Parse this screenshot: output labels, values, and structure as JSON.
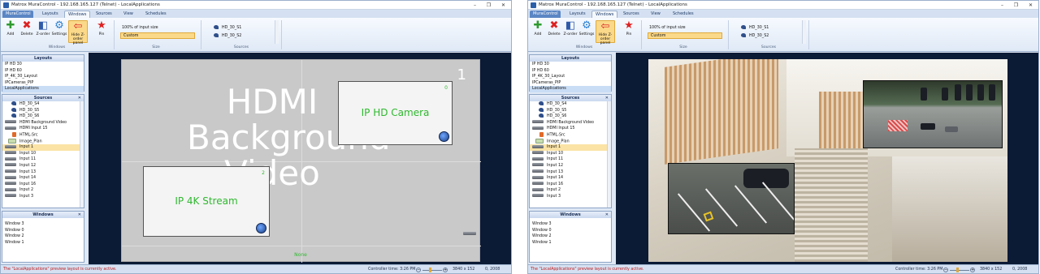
{
  "left_window": {
    "title": "Matrox MuraControl - 192.168.165.127 (Telnet) - LocalApplications",
    "menu_tabs": [
      "MuraControl",
      "Layouts",
      "Windows",
      "Sources",
      "View",
      "Schedules"
    ],
    "ribbon": {
      "buttons": [
        "Add",
        "Delete",
        "Z-order",
        "Settings",
        "Hide Z-order panel",
        "Pin"
      ],
      "group_windows": "Windows",
      "size_text": "100% of input size",
      "size_value": "Custom",
      "group_size": "Size",
      "sources": [
        "HD_30_S1",
        "HD_30_S2"
      ],
      "group_sources": "Sources"
    },
    "layouts": {
      "header": "Layouts",
      "items": [
        "IP HD 30",
        "IP HD 60",
        "IP_4K_30_Layout",
        "IPCameras_PIP",
        "LocalApplications"
      ]
    },
    "sources_panel": {
      "header": "Sources",
      "close": "✕",
      "items": [
        "HD_30_S4",
        "HD_30_S5",
        "HD_30_S6",
        "HDMI Background Video",
        "HDMI Input 15",
        "HTML-Src",
        "Image_Plan",
        "Input 1",
        "Input 10",
        "Input 11",
        "Input 12",
        "Input 13",
        "Input 14",
        "Input 16",
        "Input 2",
        "Input 3"
      ]
    },
    "windows_panel": {
      "header": "Windows",
      "close": "✕",
      "items": [
        "Window 3",
        "Window 0",
        "Window 2",
        "Window 1"
      ]
    },
    "preview": {
      "bg_lines": [
        "HDMI",
        "Background",
        "Video"
      ],
      "screen_number": "1",
      "win_ip_hd": {
        "label": "IP HD Camera",
        "number": "0"
      },
      "win_ip_4k": {
        "label": "IP 4K Stream",
        "number": "2"
      },
      "none_label": "None"
    },
    "status": {
      "message": "The \"LocalApplications\" preview layout is currently active.",
      "controller_time": "Controller time: 3:26 PM",
      "resolution": "3840 x 152",
      "coords": "0, 2008"
    }
  },
  "right_window": {
    "title": "Matrox MuraControl - 192.168.165.127 (Telnet) - LocalApplications",
    "menu_tabs": [
      "MuraControl",
      "Layouts",
      "Windows",
      "Sources",
      "View",
      "Schedules"
    ],
    "ribbon": {
      "buttons": [
        "Add",
        "Delete",
        "Z-order",
        "Settings",
        "Hide Z-order panel",
        "Pin"
      ],
      "group_windows": "Windows",
      "size_text": "100% of input size",
      "size_value": "Custom",
      "group_size": "Size",
      "sources": [
        "HD_30_S1",
        "HD_30_S2"
      ],
      "group_sources": "Sources"
    },
    "layouts": {
      "header": "Layouts",
      "items": [
        "IP HD 30",
        "IP HD 60",
        "IP_4K_30_Layout",
        "IPCameras_PIP",
        "LocalApplications"
      ]
    },
    "sources_panel": {
      "header": "Sources",
      "close": "✕",
      "items": [
        "HD_30_S4",
        "HD_30_S5",
        "HD_30_S6",
        "HDMI Background Video",
        "HDMI Input 15",
        "HTML-Src",
        "Image_Plan",
        "Input 1",
        "Input 10",
        "Input 11",
        "Input 12",
        "Input 13",
        "Input 14",
        "Input 16",
        "Input 2",
        "Input 3"
      ]
    },
    "windows_panel": {
      "header": "Windows",
      "close": "✕",
      "items": [
        "Window 3",
        "Window 0",
        "Window 2",
        "Window 1"
      ]
    },
    "status": {
      "message": "The \"LocalApplications\" preview layout is currently active.",
      "controller_time": "Controller time: 3:26 PM",
      "resolution": "3840 x 152",
      "coords": "0, 2008"
    }
  },
  "colors": {
    "accent": "#fbd98a",
    "status_error": "#c01818",
    "label_green": "#2eb82e",
    "panel_bg": "#dfe8f5"
  },
  "icons": [
    "add-icon",
    "delete-icon",
    "zorder-icon",
    "settings-icon",
    "hide-panel-icon",
    "pin-icon",
    "camera-icon",
    "video-input-icon",
    "html-source-icon",
    "image-source-icon"
  ]
}
